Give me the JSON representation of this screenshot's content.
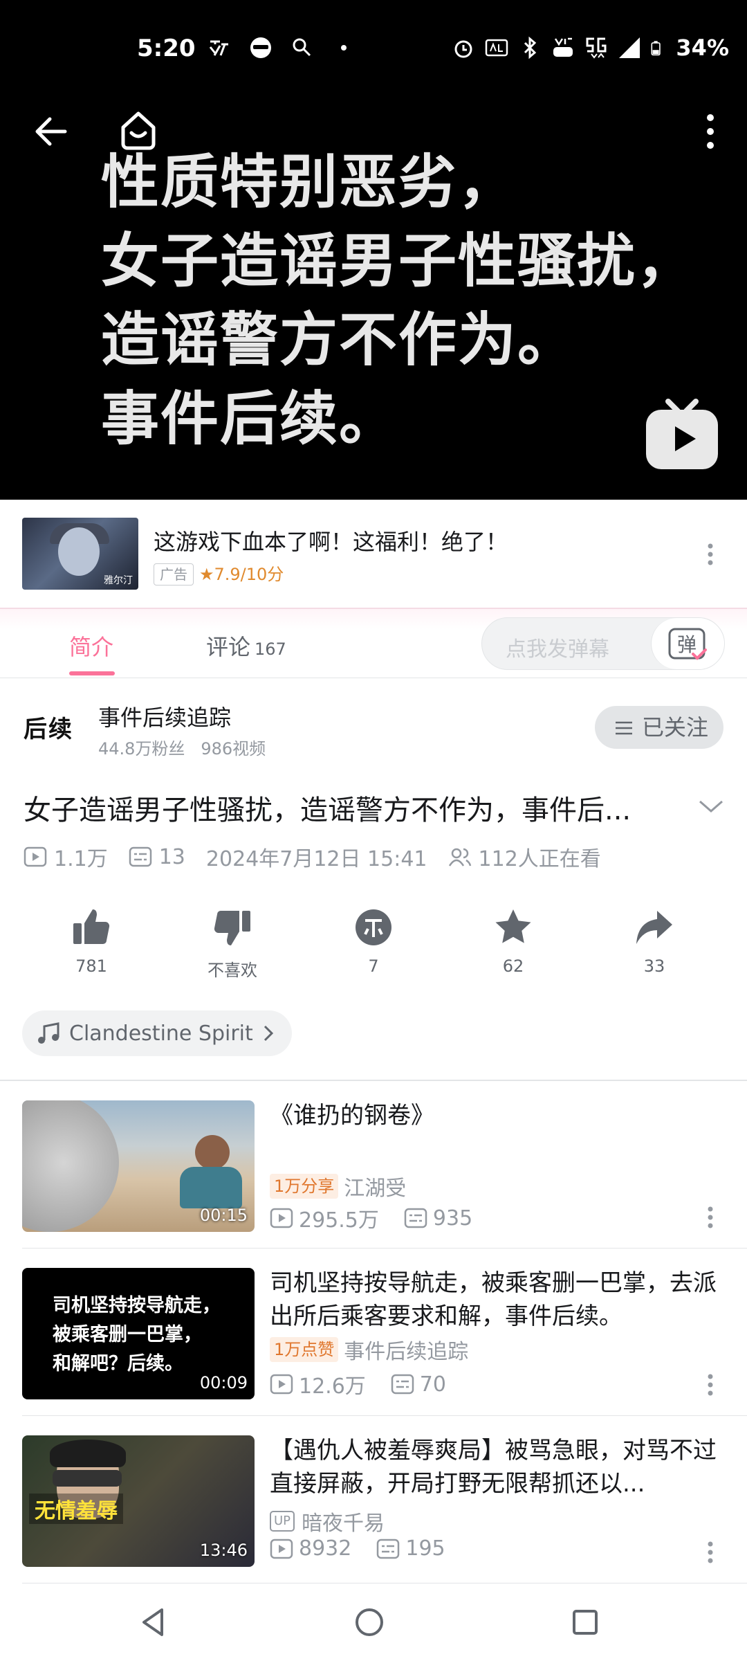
{
  "status_bar": {
    "time": "5:20",
    "battery": "34%",
    "icons_left": [
      "notification-icon",
      "avatar-icon",
      "search-alert-icon",
      "dot-icon"
    ],
    "icons_right": [
      "alarm-icon",
      "auto-hz-icon",
      "bluetooth-icon",
      "volte-icon",
      "5g-icon",
      "signal-icon",
      "battery-icon"
    ]
  },
  "player": {
    "overlay_text": "性质特别恶劣，\n女子造谣男子性骚扰，\n造谣警方不作为。\n事件后续。"
  },
  "ad": {
    "title": "这游戏下血本了啊！这福利！绝了！",
    "tag": "广告",
    "rating": "★7.9/10分",
    "thumb_text": "雅尔汀"
  },
  "tabs": {
    "intro": "简介",
    "comments": "评论",
    "comments_count": "167",
    "danmaku_placeholder": "点我发弹幕",
    "danmaku_icon": "弹"
  },
  "uploader": {
    "avatar_text": "后续",
    "name": "事件后续追踪",
    "fans": "44.8万粉丝",
    "videos": "986视频",
    "follow_label": "已关注"
  },
  "video": {
    "title": "女子造谣男子性骚扰，造谣警方不作为，事件后...",
    "views": "1.1万",
    "danmaku": "13",
    "date": "2024年7月12日 15:41",
    "watching": "112人正在看"
  },
  "actions": {
    "like": "781",
    "dislike": "不喜欢",
    "coin": "7",
    "favorite": "62",
    "share": "33"
  },
  "music": {
    "name": "Clandestine Spirit"
  },
  "related": [
    {
      "title": "《谁扔的钢卷》",
      "badge": "1万分享",
      "author": "江湖受",
      "views": "295.5万",
      "danmaku": "935",
      "duration": "00:15"
    },
    {
      "title": "司机坚持按导航走，被乘客删一巴掌，去派出所后乘客要求和解，事件后续。",
      "badge": "1万点赞",
      "author": "事件后续追踪",
      "views": "12.6万",
      "danmaku": "70",
      "duration": "00:09",
      "thumb_text": "司机坚持按导航走，\n被乘客删一巴掌，\n和解吧？后续。"
    },
    {
      "title": "【遇仇人被羞辱爽局】被骂急眼，对骂不过直接屏蔽，开局打野无限帮抓还以...",
      "badge": "UP",
      "author": "暗夜千易",
      "views": "8932",
      "danmaku": "195",
      "duration": "13:46",
      "thumb_text": "无情羞辱"
    }
  ]
}
